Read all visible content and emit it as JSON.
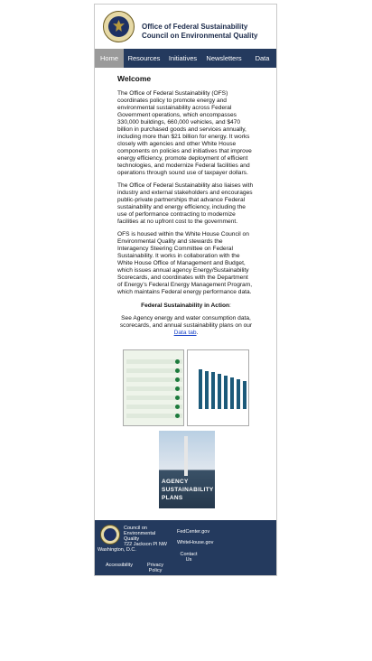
{
  "header": {
    "title_line1": "Office of Federal Sustainability",
    "title_line2": "Council on Environmental Quality"
  },
  "nav": [
    {
      "label": "Home"
    },
    {
      "label": "Resources"
    },
    {
      "label": "Initiatives"
    },
    {
      "label": "Newsletters"
    },
    {
      "label": "Data"
    }
  ],
  "main": {
    "heading": "Welcome",
    "p1": "The Office of Federal Sustainability (OFS) coordinates policy to promote energy and environmental sustainability across Federal Government operations, which encompasses 330,000 buildings, 660,000 vehicles, and $470 billion in purchased goods and services annually, including more than $21 billion for energy. It works closely with agencies and other White House components on policies and initiatives that improve energy efficiency, promote deployment of efficient technologies, and modernize Federal facilities and operations through sound use of taxpayer dollars.",
    "p2": "The Office of Federal Sustainability also liaises with industry and external stakeholders and encourages public-private partnerships that advance Federal sustainability and energy efficiency, including the use of performance contracting to modernize facilities at no upfront cost to the government.",
    "p3": "OFS is housed within the White House Council on Environmental Quality and stewards the Interagency Steering Committee on Federal Sustainability. It works in collaboration with the White House Office of Management and Budget, which issues annual agency Energy/Sustainability Scorecards, and coordinates with the Department of Energy’s Federal Energy Management Program, which maintains Federal energy performance data.",
    "subheading": "Federal Sustainability in Action",
    "subheading_suffix": ":",
    "see_text": "See Agency energy and water consumption data, scorecards, and annual sustainability plans on our",
    "data_link": "Data tab",
    "data_link_suffix": ".",
    "poster_lines": [
      "AGENCY",
      "SUSTAINABILITY",
      "PLANS"
    ]
  },
  "footer": {
    "org": "Council on Environmental Quality",
    "address1": "722 Jackson Pl NW",
    "address2": "Washington, D.C.",
    "link_fedcenter": "FedCenter.gov",
    "link_whitehouse": "WhiteHouse.gov",
    "link_contact": "Contact Us",
    "link_accessibility": "Accessibility",
    "link_privacy": "Privacy Policy"
  },
  "icons": {
    "seal": "presidential-seal-icon"
  },
  "colors": {
    "nav_bg": "#243a5e",
    "nav_active": "#9a9a9a",
    "link": "#1a44c8"
  }
}
